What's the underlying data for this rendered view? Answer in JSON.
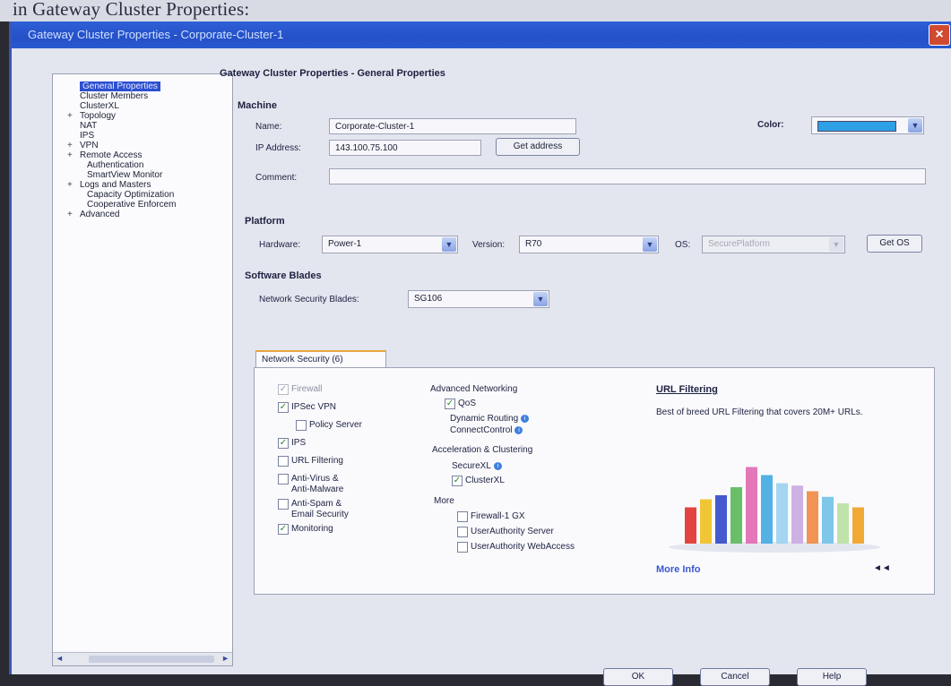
{
  "outer_caption": "in Gateway Cluster Properties:",
  "window": {
    "title": "Gateway Cluster Properties - Corporate-Cluster-1",
    "close_label": "×"
  },
  "tree": {
    "items": [
      {
        "label": "General Properties",
        "selected": true,
        "expand": "",
        "indent": 0
      },
      {
        "label": "Cluster Members",
        "selected": false,
        "expand": "",
        "indent": 0
      },
      {
        "label": "ClusterXL",
        "selected": false,
        "expand": "",
        "indent": 0
      },
      {
        "label": "Topology",
        "selected": false,
        "expand": "+",
        "indent": 0
      },
      {
        "label": "NAT",
        "selected": false,
        "expand": "",
        "indent": 0
      },
      {
        "label": "IPS",
        "selected": false,
        "expand": "",
        "indent": 0
      },
      {
        "label": "VPN",
        "selected": false,
        "expand": "+",
        "indent": 0
      },
      {
        "label": "Remote Access",
        "selected": false,
        "expand": "+",
        "indent": 0
      },
      {
        "label": "Authentication",
        "selected": false,
        "expand": "",
        "indent": 1
      },
      {
        "label": "SmartView Monitor",
        "selected": false,
        "expand": "",
        "indent": 1
      },
      {
        "label": "Logs and Masters",
        "selected": false,
        "expand": "+",
        "indent": 0
      },
      {
        "label": "Capacity Optimization",
        "selected": false,
        "expand": "",
        "indent": 1
      },
      {
        "label": "Cooperative Enforcem",
        "selected": false,
        "expand": "",
        "indent": 1
      },
      {
        "label": "Advanced",
        "selected": false,
        "expand": "+",
        "indent": 0
      }
    ],
    "scroll_left": "◄",
    "scroll_right": "►"
  },
  "general": {
    "page_title": "Gateway Cluster Properties - General Properties",
    "machine_label": "Machine",
    "name_label": "Name:",
    "name_value": "Corporate-Cluster-1",
    "ip_label": "IP Address:",
    "ip_value": "143.100.75.100",
    "get_address_label": "Get address",
    "comment_label": "Comment:",
    "comment_value": "",
    "color_label": "Color:",
    "color_value": "#2ea0e6"
  },
  "platform": {
    "label": "Platform",
    "hardware_label": "Hardware:",
    "hardware_value": "Power-1",
    "version_label": "Version:",
    "version_value": "R70",
    "os_label": "OS:",
    "os_value": "SecurePlatform",
    "get_os_label": "Get OS"
  },
  "blades": {
    "label": "Software Blades",
    "nsb_label": "Network Security Blades:",
    "nsb_value": "SG106",
    "tab_label": "Network Security (6)"
  },
  "checkboxes_left": [
    {
      "label": "Firewall",
      "checked": true,
      "disabled": true,
      "indent": 0
    },
    {
      "label": "IPSec VPN",
      "checked": true,
      "disabled": false,
      "indent": 0
    },
    {
      "label": "Policy Server",
      "checked": false,
      "disabled": false,
      "indent": 1
    },
    {
      "label": "IPS",
      "checked": true,
      "disabled": false,
      "indent": 0
    },
    {
      "label": "URL Filtering",
      "checked": false,
      "disabled": false,
      "indent": 0
    },
    {
      "label": "Anti-Virus &",
      "label2": "Anti-Malware",
      "checked": false,
      "disabled": false,
      "indent": 0
    },
    {
      "label": "Anti-Spam &",
      "label2": "Email Security",
      "checked": false,
      "disabled": false,
      "indent": 0
    },
    {
      "label": "Monitoring",
      "checked": true,
      "disabled": false,
      "indent": 0
    }
  ],
  "advanced_networking": {
    "label": "Advanced Networking",
    "qos_label": "QoS",
    "qos_checked": true,
    "dynamic_routing_label": "Dynamic Routing",
    "connect_control_label": "ConnectControl"
  },
  "acceleration": {
    "label": "Acceleration & Clustering",
    "securexl_label": "SecureXL",
    "clusterxl_label": "ClusterXL",
    "clusterxl_checked": true
  },
  "more": {
    "label": "More",
    "items": [
      {
        "label": "Firewall-1 GX",
        "checked": false
      },
      {
        "label": "UserAuthority Server",
        "checked": false
      },
      {
        "label": "UserAuthority WebAccess",
        "checked": false
      }
    ]
  },
  "info_panel": {
    "title": "URL Filtering",
    "description": "Best of breed URL Filtering that covers 20M+ URLs.",
    "more_info": "More Info",
    "collapse": "◄◄",
    "bar_colors": [
      "#e0302a",
      "#f0c020",
      "#3048c8",
      "#58b858",
      "#e068b0",
      "#40a8e0",
      "#9ad0f0",
      "#c8a8e0",
      "#f08840",
      "#70c0e8",
      "#b8e0a0",
      "#f0a020"
    ],
    "bar_levels": [
      0.45,
      0.55,
      0.6,
      0.7,
      0.95,
      0.85,
      0.75,
      0.72,
      0.65,
      0.58,
      0.5,
      0.45
    ]
  },
  "footer": {
    "ok_label": "OK",
    "cancel_label": "Cancel",
    "help_label": "Help"
  }
}
